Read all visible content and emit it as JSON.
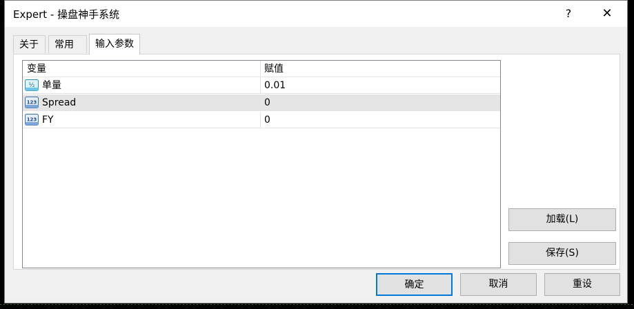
{
  "window": {
    "title": "Expert - 操盘神手系统",
    "help_label": "?",
    "close_label": "✕"
  },
  "tabs": [
    {
      "label": "关于"
    },
    {
      "label": "常用"
    },
    {
      "label": "输入参数"
    }
  ],
  "grid": {
    "columns": [
      "变量",
      "赋值"
    ],
    "rows": [
      {
        "name": "单量",
        "value": "0.01",
        "icon": "fraction-type-icon",
        "icon_text": "½"
      },
      {
        "name": "Spread",
        "value": "0",
        "icon": "integer-type-icon",
        "icon_text": "123"
      },
      {
        "name": "FY",
        "value": "0",
        "icon": "integer-type-icon",
        "icon_text": "123"
      }
    ],
    "selected_row": 1
  },
  "buttons": {
    "load": "加载(L)",
    "save": "保存(S)",
    "ok": "确定",
    "cancel": "取消",
    "reset": "重设"
  },
  "colors": {
    "focus_border": "#0078d7",
    "dialog_bg": "#f0f0f0"
  }
}
